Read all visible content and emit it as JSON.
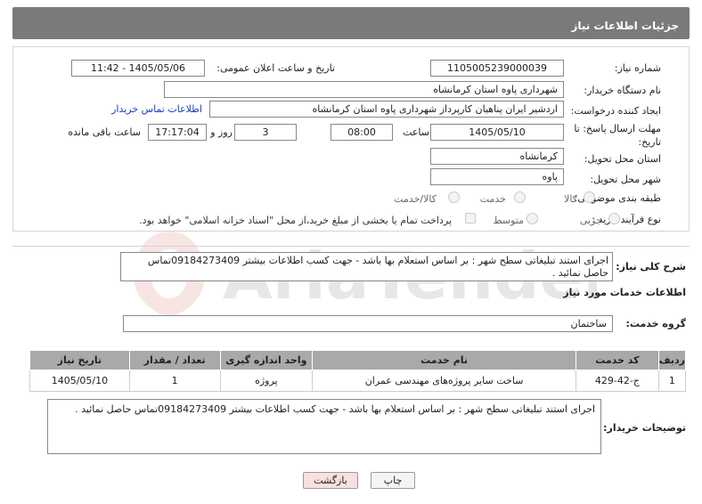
{
  "header": {
    "title": "جزئیات اطلاعات نیاز"
  },
  "form": {
    "need_number_label": "شماره نیاز:",
    "need_number": "1105005239000039",
    "announce_label": "تاریخ و ساعت اعلان عمومی:",
    "announce_value": "1405/05/06 - 11:42",
    "buyer_org_label": "نام دستگاه خریدار:",
    "buyer_org": "شهرداری پاوه استان کرمانشاه",
    "creator_label": "ایجاد کننده درخواست:",
    "creator": "اردشیر ایران پناهیان کارپرداز شهرداری پاوه استان کرمانشاه",
    "buyer_contact_link": "اطلاعات تماس خریدار",
    "deadline_label": "مهلت ارسال پاسخ: تا تاریخ:",
    "deadline_date": "1405/05/10",
    "time_label": "ساعت",
    "deadline_time": "08:00",
    "days_value": "3",
    "days_label": "روز و",
    "remaining_time": "17:17:04",
    "remaining_label": "ساعت باقی مانده",
    "province_label": "استان محل تحویل:",
    "province": "کرمانشاه",
    "city_label": "شهر محل تحویل:",
    "city": "پاوه",
    "category_label": "طبقه بندی موضوعی:",
    "category_options": [
      "کالا",
      "خدمت",
      "کالا/خدمت"
    ],
    "process_label": "نوع فرآیند خرید :",
    "process_options": [
      "جزیی",
      "متوسط"
    ],
    "payment_note": "پرداخت تمام یا بخشی از مبلغ خرید،از محل \"اسناد خزانه اسلامی\" خواهد بود."
  },
  "summary": {
    "label": "شرح کلی نیاز:",
    "text": "اجرای استند تبلیغاتی سطح شهر : بر اساس استعلام بها باشد - جهت کسب اطلاعات بیشتر 09184273409تماس حاصل نمائید ."
  },
  "services": {
    "section_title": "اطلاعات خدمات مورد نیاز",
    "group_label": "گروه خدمت:",
    "group_value": "ساختمان",
    "columns": [
      "ردیف",
      "کد خدمت",
      "نام خدمت",
      "واحد اندازه گیری",
      "تعداد / مقدار",
      "تاریخ نیاز"
    ],
    "rows": [
      [
        "1",
        "ج-42-429",
        "ساخت سایر پروژه‌های مهندسی عمران",
        "پروژه",
        "1",
        "1405/05/10"
      ]
    ]
  },
  "buyer_notes": {
    "label": "توضیحات خریدار:",
    "text": "اجرای استند تبلیغاتی سطح شهر : بر اساس استعلام بها باشد - جهت کسب اطلاعات بیشتر 09184273409تماس حاصل نمائید ."
  },
  "buttons": {
    "print": "چاپ",
    "back": "بازگشت"
  },
  "watermark": {
    "text": "AriaTender.neT"
  },
  "colors": {
    "header_bg": "#7a7a7a",
    "link": "#1a3fbf",
    "table_header": "#a9a9a9",
    "back_button": "#f9e0e0"
  }
}
